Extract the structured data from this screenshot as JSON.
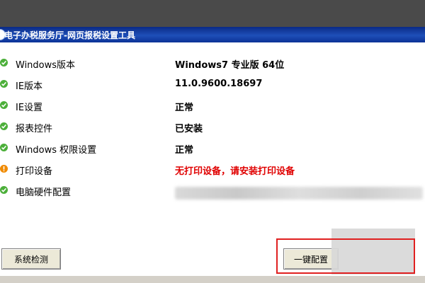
{
  "window": {
    "title": "电子办税服务厅-网页报税设置工具"
  },
  "rows": [
    {
      "label": "Windows版本",
      "value": "Windows7 专业版 64位",
      "status": "ok"
    },
    {
      "label": "IE版本",
      "value": "11.0.9600.18697",
      "status": "ok"
    },
    {
      "label": "IE设置",
      "value": "正常",
      "status": "ok"
    },
    {
      "label": "报表控件",
      "value": "已安装",
      "status": "ok"
    },
    {
      "label": "Windows 权限设置",
      "value": "正常",
      "status": "ok"
    },
    {
      "label": "打印设备",
      "value": "无打印设备，请安装打印设备",
      "status": "warning"
    },
    {
      "label": "电脑硬件配置",
      "value": "",
      "status": "ok"
    }
  ],
  "buttons": {
    "check_label": "系统检测",
    "config_label": "一键配置"
  },
  "colors": {
    "ok": "#4caf3a",
    "warning": "#f08a00",
    "warning_text": "#e00000",
    "highlight": "#e02020"
  },
  "icons": {
    "ok": "check-circle-icon",
    "warning": "exclamation-circle-icon"
  }
}
